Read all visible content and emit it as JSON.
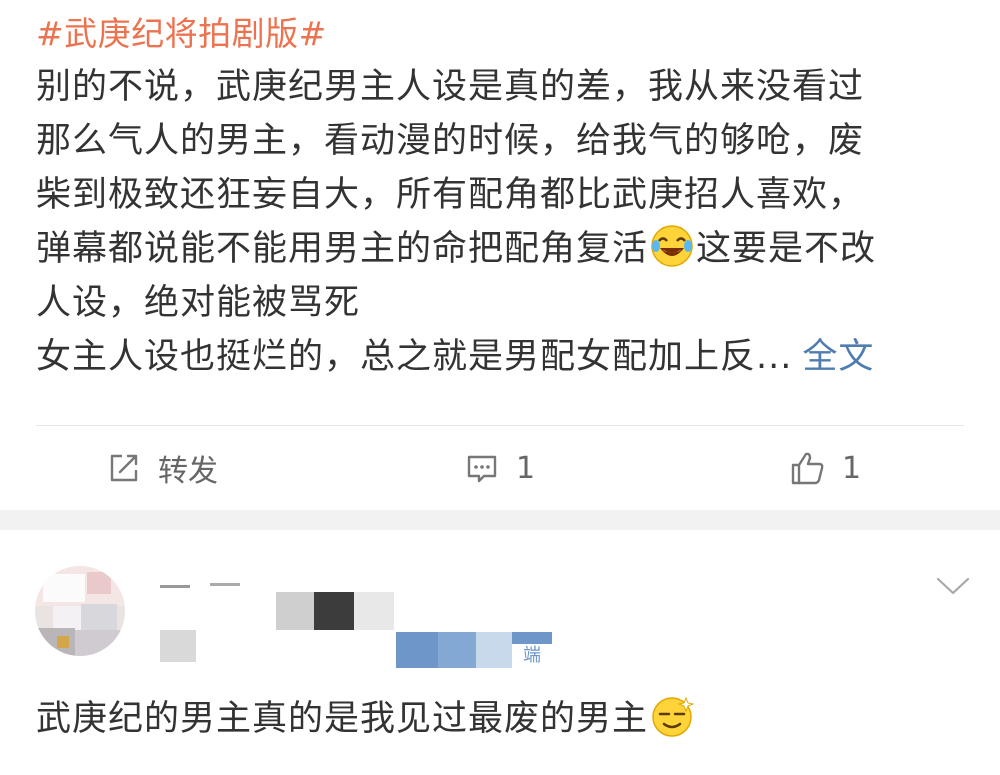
{
  "post": {
    "topic": "#武庚纪将拍剧版#",
    "lines": [
      "别的不说，武庚纪男主人设是真的差，我从来没看过",
      "那么气人的男主，看动漫的时候，给我气的够呛，废",
      "柴到极致还狂妄自大，所有配角都比武庚招人喜欢，",
      "弹幕都说能不能用男主的命把配角复活",
      "这要是不改",
      "人设，绝对能被骂死",
      "女主人设也挺烂的，总之就是男配女配加上反..."
    ],
    "full_text_link": "全文",
    "emoji_1": "laughing-tears-emoji"
  },
  "actions": {
    "repost_label": "转发",
    "comment_count": "1",
    "like_count": "1"
  },
  "comment": {
    "text": "武庚纪的男主真的是我见过最废的男主",
    "emoji": "sweat-smile-emoji",
    "badge_text": "端"
  },
  "colors": {
    "topic": "#eb7350",
    "link": "#507daf",
    "text": "#333333",
    "secondary": "#666666",
    "separator": "#f2f2f2"
  }
}
